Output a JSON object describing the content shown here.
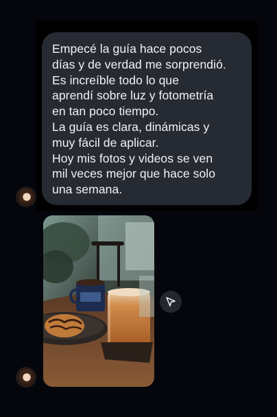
{
  "conversation": {
    "messages": [
      {
        "type": "text",
        "text": "Empecé la guía hace pocos\ndías y de verdad me sorprendió.\nEs increíble todo lo que\naprendí sobre luz y fotometría\nen tan poco tiempo.\nLa guía es clara, dinámicas y\nmuy fácil de aplicar.\nHoy mis fotos y videos se ven\nmil veces mejor que hace solo\nuna semana."
      },
      {
        "type": "image",
        "image_alt": "Café con leche en vaso, taza azul y galleta sobre una mesa de madera"
      }
    ]
  },
  "icons": {
    "share": "send-arrow-icon",
    "avatar": "user-avatar"
  },
  "colors": {
    "background": "#04060c",
    "bubble": "#262a33",
    "text": "#f2f3f5",
    "share_button": "#23272f"
  }
}
